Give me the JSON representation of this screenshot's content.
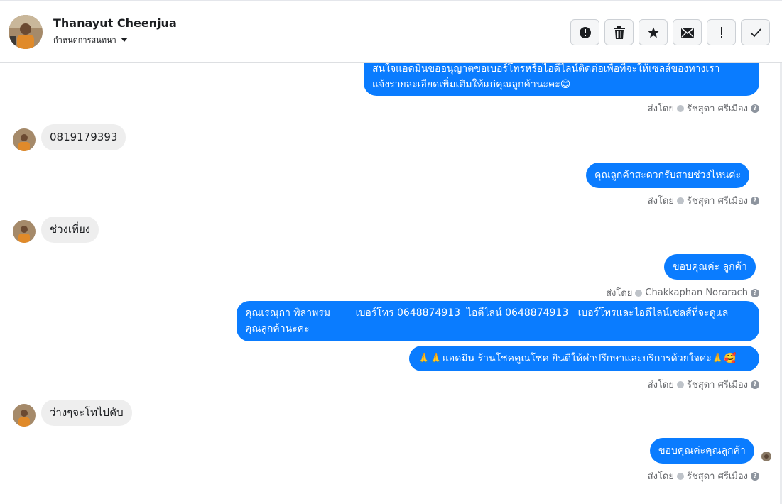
{
  "header": {
    "name": "Thanayut Cheenjua",
    "subtitle": "กำหนดการสนทนา",
    "actions": [
      {
        "icon": "alert-circle-icon"
      },
      {
        "icon": "trash-icon"
      },
      {
        "icon": "star-icon"
      },
      {
        "icon": "envelope-icon"
      },
      {
        "icon": "exclamation-icon"
      },
      {
        "icon": "checkmark-icon"
      }
    ]
  },
  "conversation": {
    "msg1": {
      "line1": "สนใจแอดมินขออนุญาตขอเบอร์โทรหรือไอดีไลน์ติดต่อเพื่อที่จะให้เซลส์ของทางเรา",
      "line2": "แจ้งรายละเอียดเพิ่มเติมให้แก่คุณลูกค้านะคะ😊"
    },
    "sent1": {
      "prefix": "ส่งโดย",
      "sender": "รัชสุดา ศรีเมือง"
    },
    "msg2": {
      "text": "0819179393"
    },
    "msg3": {
      "text": "คุณลูกค้าสะดวกรับสายช่วงไหนค่ะ"
    },
    "sent2": {
      "prefix": "ส่งโดย",
      "sender": "รัชสุดา ศรีเมือง"
    },
    "msg4": {
      "text": "ช่วงเที่ยง"
    },
    "msg5": {
      "text": "ขอบคุณค่ะ ลูกค้า"
    },
    "sent3": {
      "prefix": "ส่งโดย",
      "sender": "Chakkaphan Norarach"
    },
    "msg6": {
      "line1": "คุณเรณุกา พิลาพรม        เบอร์โทร 0648874913  ไอดีไลน์ 0648874913   เบอร์โทรและไอดีไลน์เซลส์ที่จะดูแล",
      "line2": "คุณลูกค้านะคะ"
    },
    "msg7": {
      "text": "🙏🙏แอดมิน ร้านโชคคูณโชค ยินดีให้คำปรึกษาและบริการด้วยใจค่ะ🙏🥰"
    },
    "sent4": {
      "prefix": "ส่งโดย",
      "sender": "รัชสุดา ศรีเมือง"
    },
    "msg8": {
      "text": "ว่างๆจะโทไปคับ"
    },
    "msg9": {
      "text": "ขอบคุณค่ะคุณลูกค้า"
    },
    "sent5": {
      "prefix": "ส่งโดย",
      "sender": "รัชสุดา ศรีเมือง"
    }
  },
  "colors": {
    "outgoing": "#0a7cff",
    "incoming": "#eeeeee",
    "meta": "#65676b"
  }
}
